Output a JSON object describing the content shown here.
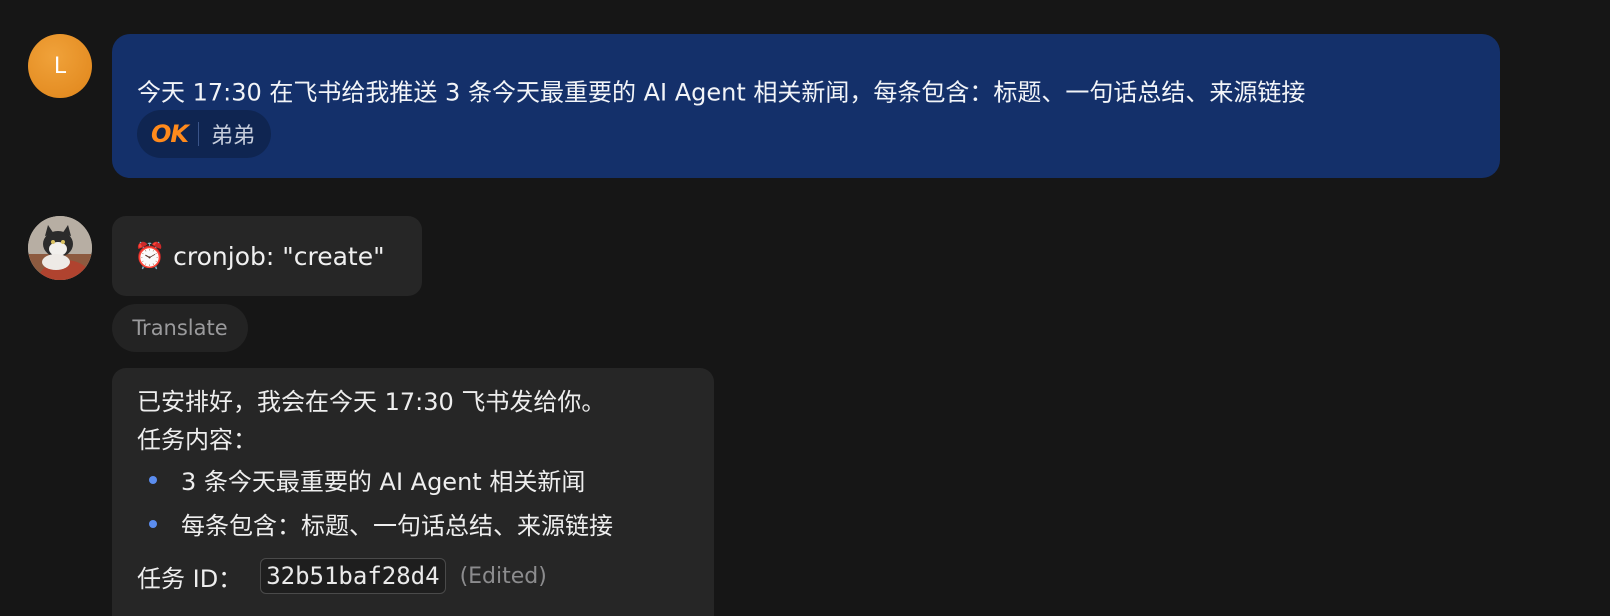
{
  "messages": {
    "user": {
      "avatar_initial": "L",
      "text": "今天 17:30 在飞书给我推送 3 条今天最重要的 AI Agent 相关新闻，每条包含：标题、一句话总结、来源链接",
      "reaction": {
        "emoji_text": "OK",
        "name": "弟弟"
      },
      "bubble_color": "#14306a"
    },
    "tool_call": {
      "icon": "alarm-clock-icon",
      "icon_glyph": "⏰",
      "label": "cronjob: \"create\""
    },
    "translate_label": "Translate",
    "reply": {
      "line1": "已安排好，我会在今天 17:30 飞书发给你。",
      "line2": "任务内容：",
      "bullets": [
        "3 条今天最重要的 AI Agent 相关新闻",
        "每条包含：标题、一句话总结、来源链接"
      ],
      "task_id_label": "任务 ID：",
      "task_id": "32b51baf28d4",
      "edited_label": "(Edited)"
    }
  },
  "colors": {
    "background": "#161616",
    "user_bubble": "#14306a",
    "bot_bubble": "#262626",
    "bullet": "#5b8def",
    "reaction_accent": "#ff8a1c"
  }
}
